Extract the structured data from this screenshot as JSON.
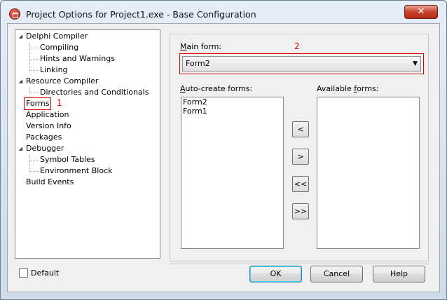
{
  "window": {
    "title": "Project Options for Project1.exe - Base Configuration",
    "close_glyph": "✕"
  },
  "tree": {
    "items": [
      {
        "label": "Delphi Compiler",
        "expander": "◢"
      },
      {
        "label": "Compiling"
      },
      {
        "label": "Hints and Warnings"
      },
      {
        "label": "Linking"
      },
      {
        "label": "Resource Compiler",
        "expander": "◢"
      },
      {
        "label": "Directories and Conditionals"
      },
      {
        "label": "Forms",
        "selected": true
      },
      {
        "label": "Application"
      },
      {
        "label": "Version Info"
      },
      {
        "label": "Packages"
      },
      {
        "label": "Debugger",
        "expander": "◢"
      },
      {
        "label": "Symbol Tables"
      },
      {
        "label": "Environment Block"
      },
      {
        "label": "Build Events"
      }
    ],
    "marker": "1"
  },
  "forms_page": {
    "main_form_label_first": "M",
    "main_form_label_rest": "ain form:",
    "main_form_value": "Form2",
    "marker": "2",
    "auto_create_label_first": "A",
    "auto_create_label_rest": "uto-create forms:",
    "auto_create_items": [
      "Form2",
      "Form1"
    ],
    "available_label_pre": "Available ",
    "available_label_u": "f",
    "available_label_rest": "orms:",
    "available_items": [],
    "move_buttons": [
      "<",
      ">",
      "<<",
      ">>"
    ]
  },
  "default_checkbox": {
    "label": "Default",
    "checked": false
  },
  "buttons": {
    "ok": "OK",
    "cancel": "Cancel",
    "help": "Help"
  },
  "colors": {
    "accent_red": "#dd0000"
  }
}
